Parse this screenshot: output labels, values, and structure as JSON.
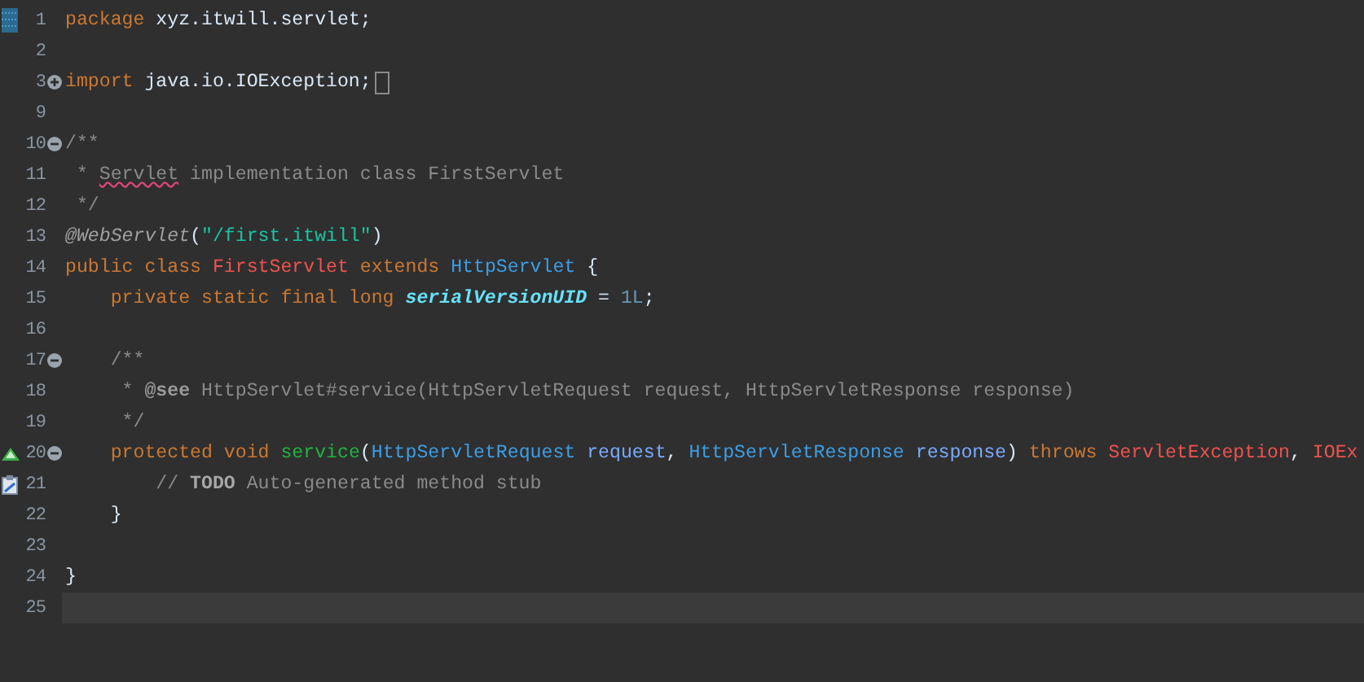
{
  "editor": {
    "lines": [
      {
        "number": "1",
        "gutter_icon": {
          "kind": "marker"
        },
        "tokens": [
          {
            "kind": "kw",
            "t": "package "
          },
          {
            "kind": "plain",
            "t": "xyz.itwill.servlet;"
          }
        ]
      },
      {
        "number": "2"
      },
      {
        "number": "3",
        "fold_marker": {
          "kind": "collapsed"
        },
        "folded": true,
        "tokens": [
          {
            "kind": "kw",
            "t": "import "
          },
          {
            "kind": "plain",
            "t": "java.io.IOException;"
          }
        ]
      },
      {
        "number": "9"
      },
      {
        "number": "10",
        "fold_marker": {
          "kind": "expanded"
        },
        "tokens": [
          {
            "kind": "comment",
            "t": "/**"
          }
        ]
      },
      {
        "number": "11",
        "tokens": [
          {
            "kind": "comment",
            "t": " * "
          },
          {
            "kind": "misspelled",
            "t": "Servlet"
          },
          {
            "kind": "comment",
            "t": " implementation class FirstServlet"
          }
        ]
      },
      {
        "number": "12",
        "tokens": [
          {
            "kind": "comment",
            "t": " */"
          }
        ]
      },
      {
        "number": "13",
        "tokens": [
          {
            "kind": "annotation",
            "t": "@WebServlet"
          },
          {
            "kind": "plain",
            "t": "("
          },
          {
            "kind": "string",
            "t": "\"/first.itwill\""
          },
          {
            "kind": "plain",
            "t": ")"
          }
        ]
      },
      {
        "number": "14",
        "tokens": [
          {
            "kind": "kw",
            "t": "public class "
          },
          {
            "kind": "classname",
            "t": "FirstServlet"
          },
          {
            "kind": "kw",
            "t": " extends "
          },
          {
            "kind": "type",
            "t": "HttpServlet"
          },
          {
            "kind": "plain",
            "t": " {"
          }
        ]
      },
      {
        "number": "15",
        "tokens": [
          {
            "kind": "kw",
            "t": "    private static final long "
          },
          {
            "kind": "field",
            "t": "serialVersionUID"
          },
          {
            "kind": "plain",
            "t": " = "
          },
          {
            "kind": "number",
            "t": "1L"
          },
          {
            "kind": "plain",
            "t": ";"
          }
        ]
      },
      {
        "number": "16"
      },
      {
        "number": "17",
        "fold_marker": {
          "kind": "expanded"
        },
        "tokens": [
          {
            "kind": "comment",
            "t": "    /**"
          }
        ]
      },
      {
        "number": "18",
        "tokens": [
          {
            "kind": "comment",
            "t": "     * "
          },
          {
            "kind": "doctag",
            "t": "@see"
          },
          {
            "kind": "comment",
            "t": " HttpServlet#service(HttpServletRequest request, HttpServletResponse response)"
          }
        ]
      },
      {
        "number": "19",
        "tokens": [
          {
            "kind": "comment",
            "t": "     */"
          }
        ]
      },
      {
        "number": "20",
        "fold_marker": {
          "kind": "expanded"
        },
        "gutter_icon": {
          "kind": "override"
        },
        "tokens": [
          {
            "kind": "kw",
            "t": "    protected void "
          },
          {
            "kind": "method",
            "t": "service"
          },
          {
            "kind": "plain",
            "t": "("
          },
          {
            "kind": "type",
            "t": "HttpServletRequest "
          },
          {
            "kind": "param",
            "t": "request"
          },
          {
            "kind": "plain",
            "t": ", "
          },
          {
            "kind": "type",
            "t": "HttpServletResponse "
          },
          {
            "kind": "param",
            "t": "response"
          },
          {
            "kind": "plain",
            "t": ") "
          },
          {
            "kind": "kw",
            "t": "throws "
          },
          {
            "kind": "classname",
            "t": "ServletException"
          },
          {
            "kind": "plain",
            "t": ", "
          },
          {
            "kind": "classname",
            "t": "IOEx"
          }
        ]
      },
      {
        "number": "21",
        "gutter_icon": {
          "kind": "task"
        },
        "tokens": [
          {
            "kind": "comment",
            "t": "        // "
          },
          {
            "kind": "todo",
            "t": "TODO"
          },
          {
            "kind": "comment",
            "t": " Auto-generated method stub"
          }
        ]
      },
      {
        "number": "22",
        "tokens": [
          {
            "kind": "plain",
            "t": "    }"
          }
        ]
      },
      {
        "number": "23"
      },
      {
        "number": "24",
        "tokens": [
          {
            "kind": "plain",
            "t": "}"
          }
        ]
      },
      {
        "number": "25",
        "current": true
      }
    ]
  }
}
